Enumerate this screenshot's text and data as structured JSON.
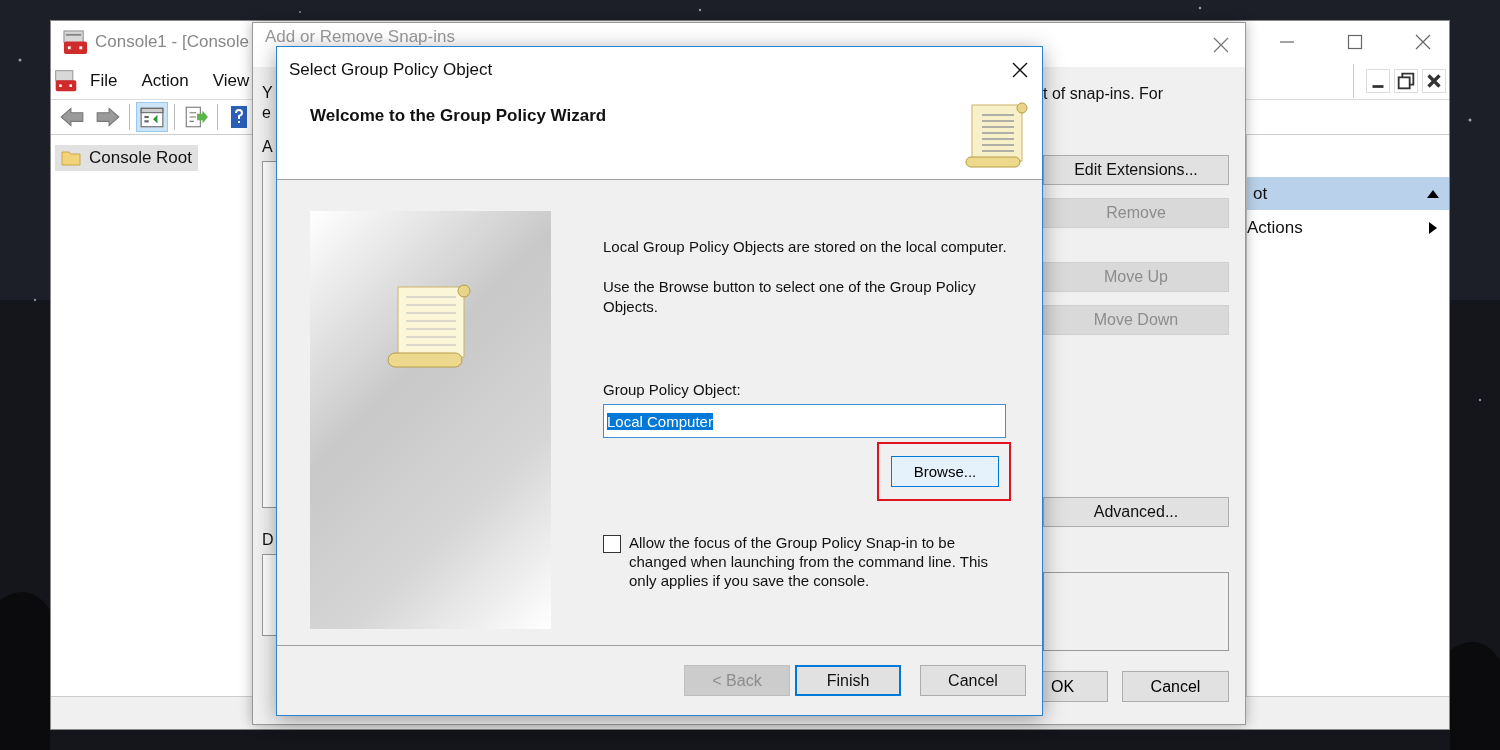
{
  "console": {
    "title": "Console1 - [Console",
    "menu": [
      {
        "label": "File"
      },
      {
        "label": "Action"
      },
      {
        "label": "View"
      }
    ],
    "tree": [
      {
        "label": "Console Root",
        "selected": true
      }
    ],
    "actions": {
      "header": "ot",
      "items": [
        {
          "label": "Actions"
        }
      ]
    }
  },
  "snapins": {
    "title": "Add or Remove Snap-ins",
    "intro": "t of snap-ins. For",
    "edge_letters": [
      "Y",
      "e",
      "A",
      "D"
    ],
    "buttons": [
      {
        "label": "Edit Extensions...",
        "disabled": false
      },
      {
        "label": "Remove",
        "disabled": true
      },
      {
        "label": "Move Up",
        "disabled": true
      },
      {
        "label": "Move Down",
        "disabled": true
      },
      {
        "label": "Advanced...",
        "disabled": false
      }
    ],
    "footer_buttons": [
      {
        "label": "OK"
      },
      {
        "label": "Cancel"
      }
    ]
  },
  "dialog": {
    "title": "Select Group Policy Object",
    "heading": "Welcome to the Group Policy Wizard",
    "paragraphs": [
      "Local Group Policy Objects are stored on the local computer.",
      "Use the Browse button to select one of the Group Policy Objects."
    ],
    "field": {
      "label": "Group Policy Object:",
      "value": "Local Computer",
      "selected": true
    },
    "browse": {
      "label": "Browse...",
      "highlighted": true
    },
    "checkbox": {
      "label": "Allow the focus of the Group Policy Snap-in to be changed when launching from the command line.  This only applies if you save the console.",
      "checked": false
    },
    "buttons": [
      {
        "label": "< Back",
        "disabled": true,
        "default": false
      },
      {
        "label": "Finish",
        "disabled": false,
        "default": true
      },
      {
        "label": "Cancel",
        "disabled": false,
        "default": false
      }
    ]
  }
}
